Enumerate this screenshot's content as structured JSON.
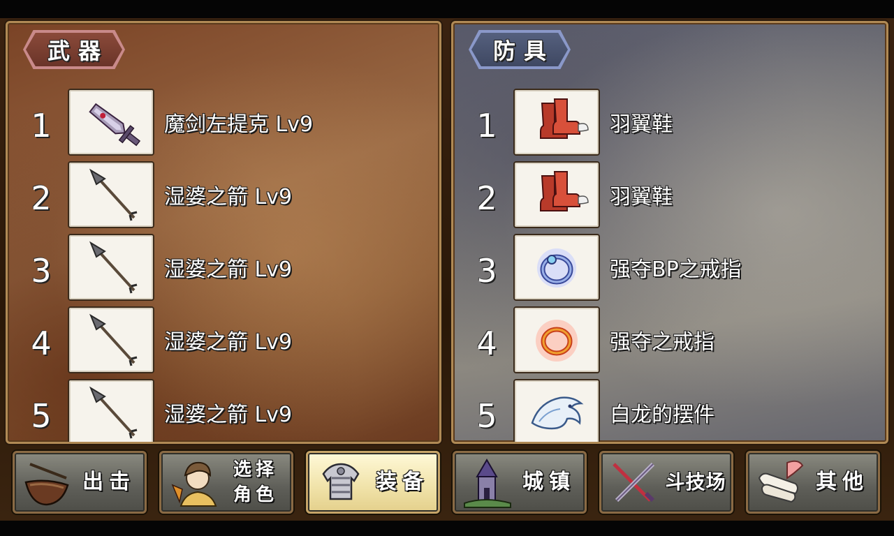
{
  "weapons": {
    "title": "武器",
    "items": [
      {
        "num": "1",
        "name": "魔剑左提克 Lv9",
        "icon": "cursed-sword-icon"
      },
      {
        "num": "2",
        "name": "湿婆之箭 Lv9",
        "icon": "arrow-icon"
      },
      {
        "num": "3",
        "name": "湿婆之箭 Lv9",
        "icon": "arrow-icon"
      },
      {
        "num": "4",
        "name": "湿婆之箭 Lv9",
        "icon": "arrow-icon"
      },
      {
        "num": "5",
        "name": "湿婆之箭 Lv9",
        "icon": "arrow-icon"
      }
    ]
  },
  "armor": {
    "title": "防具",
    "items": [
      {
        "num": "1",
        "name": "羽翼鞋",
        "icon": "winged-boots-icon"
      },
      {
        "num": "2",
        "name": "羽翼鞋",
        "icon": "winged-boots-icon"
      },
      {
        "num": "3",
        "name": "强夺BP之戒指",
        "icon": "blue-ring-icon"
      },
      {
        "num": "4",
        "name": "强夺之戒指",
        "icon": "orange-ring-icon"
      },
      {
        "num": "5",
        "name": "白龙的摆件",
        "icon": "white-dragon-icon"
      }
    ]
  },
  "nav": {
    "sortie": "出击",
    "select_line1": "选择",
    "select_line2": "角色",
    "equipment": "装备",
    "town": "城镇",
    "arena": "斗技场",
    "other": "其他",
    "active": "equipment"
  },
  "colors": {
    "weapons_panel": "#8a5a35",
    "armor_panel": "#7d7b78",
    "frame_border": "#b08a55",
    "active_tab": "#f0e2a8"
  }
}
